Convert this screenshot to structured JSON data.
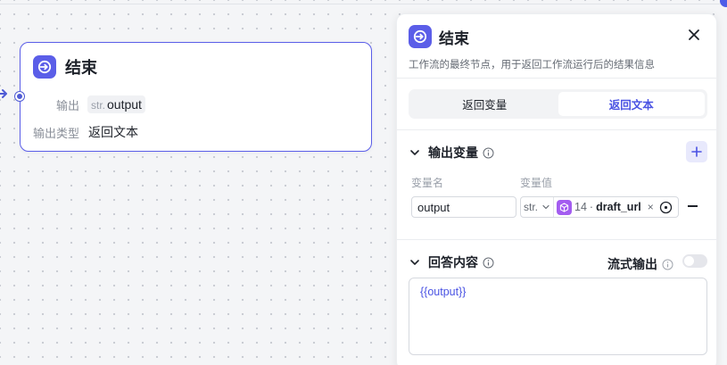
{
  "node": {
    "title": "结束",
    "output_label": "输出",
    "output_type_tag": "str.",
    "output_value": "output",
    "output_type_label": "输出类型",
    "output_type_value": "返回文本"
  },
  "panel": {
    "title": "结束",
    "description": "工作流的最终节点，用于返回工作流运行后的结果信息",
    "tabs": [
      {
        "label": "返回变量",
        "active": false
      },
      {
        "label": "返回文本",
        "active": true
      }
    ],
    "output_section": {
      "title": "输出变量",
      "col_name": "变量名",
      "col_value": "变量值",
      "rows": [
        {
          "name": "output",
          "type": "str.",
          "ref_number": "14",
          "ref_separator": "·",
          "ref_name": "draft_url",
          "remove_symbol": "×"
        }
      ]
    },
    "answer_section": {
      "title": "回答内容",
      "stream_label": "流式输出",
      "stream_enabled": false,
      "content": "{{output}}"
    }
  },
  "colors": {
    "accent": "#5b5ee8",
    "reference_icon": "#a35cf0",
    "link_text": "#4a53e3"
  },
  "icons": {
    "node": "end-node-icon",
    "close": "close-icon",
    "chevron": "chevron-down-icon",
    "info": "info-icon",
    "add": "plus-icon",
    "reference": "cube-icon",
    "target": "target-icon"
  }
}
